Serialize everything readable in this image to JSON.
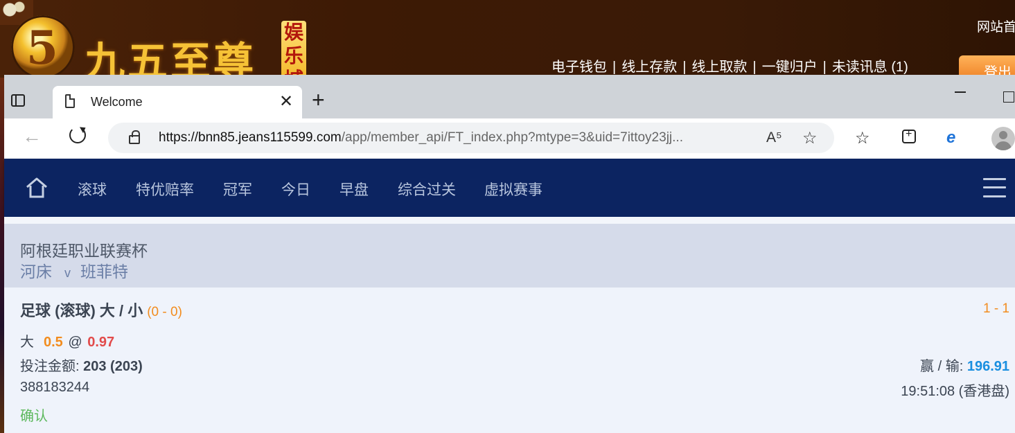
{
  "background_site": {
    "logo_number": "5",
    "logo_text": "九五至尊",
    "logo_badge": "娱乐城",
    "site_home": "网站首",
    "links": [
      "电子钱包",
      "线上存款",
      "线上取款",
      "一键归户",
      "未读讯息 (1)"
    ],
    "link_separator": "|",
    "login": "登出"
  },
  "browser": {
    "tab_title": "Welcome",
    "url_host": "https://bnn85.jeans115599.com",
    "url_path": "/app/member_api/FT_index.php?mtype=3&uid=7ittoy23jj...",
    "read_aloud_glyph": "A⁵"
  },
  "nav": {
    "items": [
      "滚球",
      "特优赔率",
      "冠军",
      "今日",
      "早盘",
      "综合过关",
      "虚拟赛事"
    ]
  },
  "match": {
    "league": "阿根廷职业联赛杯",
    "home": "河床",
    "vs": "v",
    "away": "班菲特"
  },
  "bet": {
    "title": "足球 (滚球) 大 / 小",
    "bet_score": "(0 - 0)",
    "live_score": "1 - 1",
    "selection": "大",
    "handicap": "0.5",
    "at": "@",
    "odds": "0.97",
    "stake_label": "投注金额:",
    "stake_value": "203 (203)",
    "win_label": "赢 / 输:",
    "win_value": "196.91",
    "ticket_id": "388183244",
    "time": "19:51:08 (香港盘)",
    "status": "确认"
  },
  "colors": {
    "nav_bg": "#0c2461",
    "accent_orange": "#f28c1e",
    "odds_red": "#e24b4b",
    "win_blue": "#1a8fe0",
    "status_green": "#5cb85c"
  }
}
